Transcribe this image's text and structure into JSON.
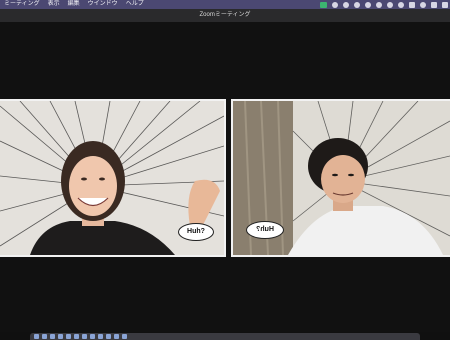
{
  "menubar": {
    "items": [
      "ミーティング",
      "表示",
      "編集",
      "ウインドウ",
      "ヘルプ"
    ]
  },
  "window": {
    "title": "Zoomミーティング"
  },
  "participants": [
    {
      "bubble": "Huh?"
    },
    {
      "bubble": "Huh?"
    }
  ],
  "colors": {
    "menubar": "#4b4872",
    "stage": "#101010",
    "tile_border": "#f2f2f2"
  }
}
